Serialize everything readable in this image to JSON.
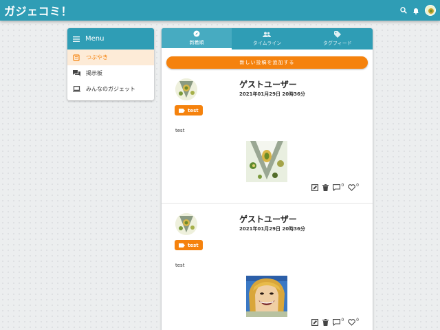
{
  "app": {
    "title": "ガジェコミ！"
  },
  "menu": {
    "header": "Menu",
    "items": [
      {
        "label": "つぶやき",
        "icon": "note-icon",
        "active": true
      },
      {
        "label": "掲示板",
        "icon": "forum-icon",
        "active": false
      },
      {
        "label": "みんなのガジェット",
        "icon": "laptop-icon",
        "active": false
      }
    ]
  },
  "tabs": [
    {
      "label": "新着順",
      "icon": "compass-icon",
      "active": true
    },
    {
      "label": "タイムライン",
      "icon": "people-icon",
      "active": false
    },
    {
      "label": "タグフィード",
      "icon": "tag-icon",
      "active": false
    }
  ],
  "add_post_label": "新しい投稿を追加する",
  "posts": [
    {
      "user": "ゲストユーザー",
      "date": "2021年01月29日 20時36分",
      "tag": "test",
      "text": "test",
      "comment_count": "0",
      "like_count": "0",
      "image": "food-photo"
    },
    {
      "user": "ゲストユーザー",
      "date": "2021年01月29日 20時36分",
      "tag": "test",
      "text": "test",
      "comment_count": "0",
      "like_count": "0",
      "image": "face-illustration"
    }
  ],
  "colors": {
    "primary": "#2f9db5",
    "accent": "#f5820d",
    "active_bg": "#fdebd7"
  }
}
